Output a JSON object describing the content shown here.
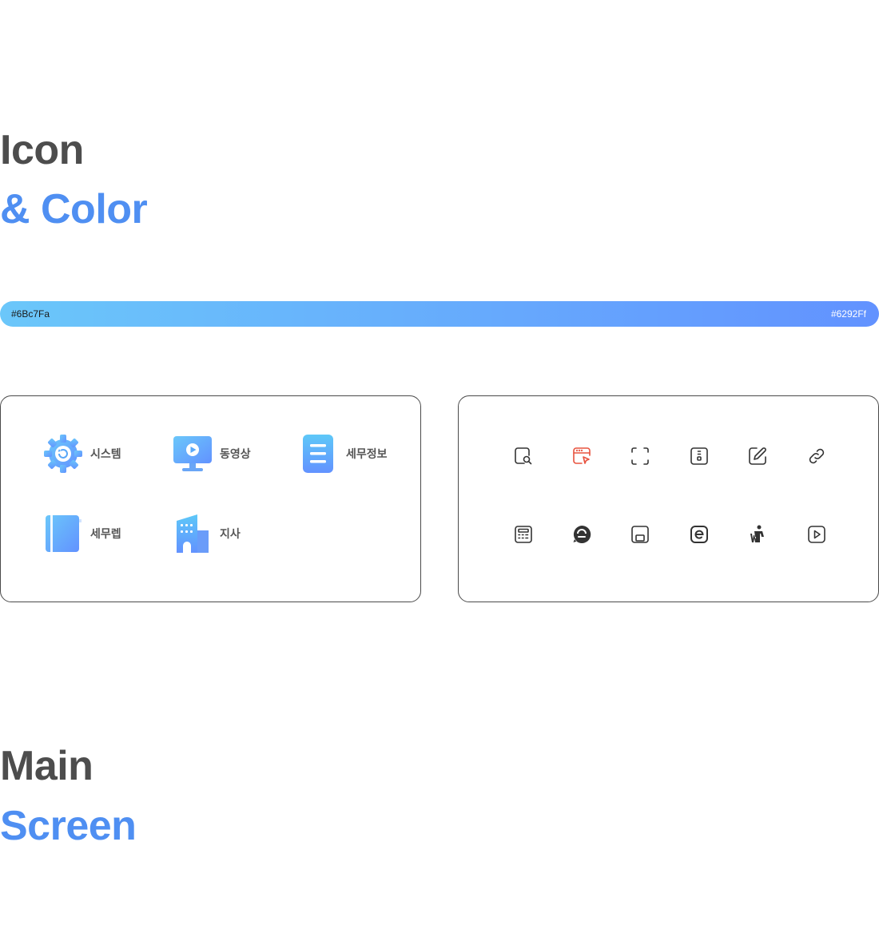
{
  "headings": {
    "icon": "Icon",
    "color": "& Color",
    "main": "Main",
    "screen": "Screen"
  },
  "gradient": {
    "start_label": "#6Bc7Fa",
    "end_label": "#6292Ff",
    "start_color": "#6bc7fa",
    "end_color": "#6292ff"
  },
  "menu_icons": [
    {
      "icon": "gear-icon",
      "label": "시스템"
    },
    {
      "icon": "monitor-play-icon",
      "label": "동영상"
    },
    {
      "icon": "document-icon",
      "label": "세무정보"
    },
    {
      "icon": "book-icon",
      "label": "세무렙"
    },
    {
      "icon": "building-icon",
      "label": "지사"
    }
  ],
  "line_icons": [
    {
      "icon": "file-search-icon",
      "color": "#333333"
    },
    {
      "icon": "browser-cursor-icon",
      "color": "#e8533f"
    },
    {
      "icon": "fullscreen-icon",
      "color": "#333333"
    },
    {
      "icon": "phone-icon",
      "color": "#333333"
    },
    {
      "icon": "edit-icon",
      "color": "#333333"
    },
    {
      "icon": "link-icon",
      "color": "#333333"
    },
    {
      "icon": "calculator-icon",
      "color": "#333333"
    },
    {
      "icon": "chat-bubble-icon",
      "color": "#333333"
    },
    {
      "icon": "window-bottom-icon",
      "color": "#333333"
    },
    {
      "icon": "e-badge-icon",
      "color": "#333333"
    },
    {
      "icon": "worker-icon",
      "color": "#333333"
    },
    {
      "icon": "play-square-icon",
      "color": "#333333"
    }
  ]
}
